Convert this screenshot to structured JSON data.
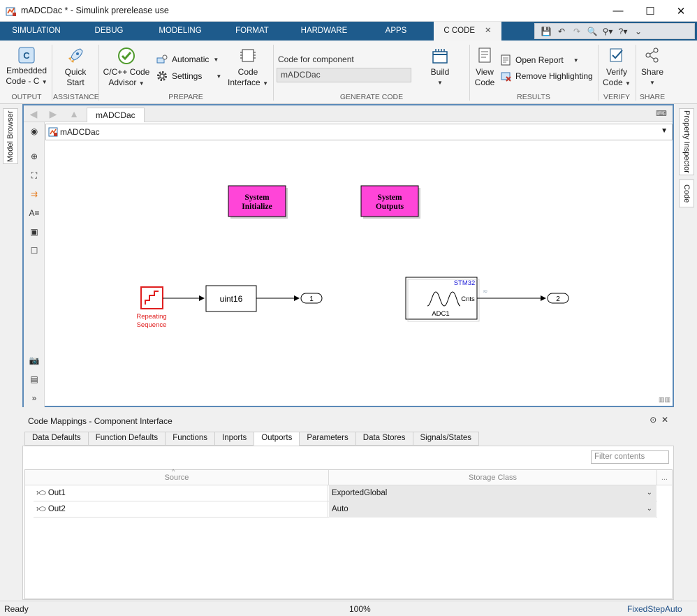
{
  "window": {
    "title": "mADCDac * - Simulink prerelease use",
    "minimize": "—",
    "maximize": "☐",
    "close": "✕"
  },
  "tabs": [
    "SIMULATION",
    "DEBUG",
    "MODELING",
    "FORMAT",
    "HARDWARE",
    "APPS",
    "C CODE"
  ],
  "active_tab": "C CODE",
  "toolstrip": {
    "output": {
      "button_line1": "Embedded",
      "button_line2": "Code - C",
      "label": "OUTPUT"
    },
    "assistance": {
      "button_line1": "Quick",
      "button_line2": "Start",
      "label": "ASSISTANCE"
    },
    "prepare": {
      "advisor_line1": "C/C++ Code",
      "advisor_line2": "Advisor",
      "automatic": "Automatic",
      "settings": "Settings",
      "interface_line1": "Code",
      "interface_line2": "Interface",
      "label": "PREPARE"
    },
    "generate": {
      "component_label": "Code for component",
      "component_value": "mADCDac",
      "build": "Build",
      "label": "GENERATE CODE"
    },
    "results": {
      "view_line1": "View",
      "view_line2": "Code",
      "open_report": "Open Report",
      "remove_highlighting": "Remove Highlighting",
      "label": "RESULTS"
    },
    "verify": {
      "button_line1": "Verify",
      "button_line2": "Code",
      "label": "VERIFY"
    },
    "share": {
      "button": "Share",
      "label": "SHARE"
    }
  },
  "left_dock": {
    "model_browser": "Model Browser"
  },
  "right_dock": {
    "property_inspector": "Property Inspector",
    "code": "Code"
  },
  "editor": {
    "model_tab": "mADCDac",
    "address": "mADCDac"
  },
  "diagram": {
    "system_initialize": "System\nInitialize",
    "system_outputs": "System\nOutputs",
    "repeating_line1": "Repeating",
    "repeating_line2": "Sequence",
    "convert": "uint16",
    "outport1": "1",
    "outport2": "2",
    "adc_vendor": "STM32",
    "adc_port": "Cnts",
    "adc_name": "ADC1",
    "colors": {
      "function_block": "#ff45d8",
      "repeating": "#e02020",
      "stm32_text": "#1a1ad6"
    }
  },
  "code_mappings": {
    "title": "Code Mappings - Component Interface",
    "tabs": [
      "Data Defaults",
      "Function Defaults",
      "Functions",
      "Inports",
      "Outports",
      "Parameters",
      "Data Stores",
      "Signals/States"
    ],
    "active_tab": "Outports",
    "filter_placeholder": "Filter contents",
    "columns": [
      "Source",
      "Storage Class"
    ],
    "more": "...",
    "rows": [
      {
        "source": "Out1",
        "storage_class": "ExportedGlobal"
      },
      {
        "source": "Out2",
        "storage_class": "Auto"
      }
    ]
  },
  "status": {
    "left": "Ready",
    "zoom": "100%",
    "solver": "FixedStepAuto"
  }
}
